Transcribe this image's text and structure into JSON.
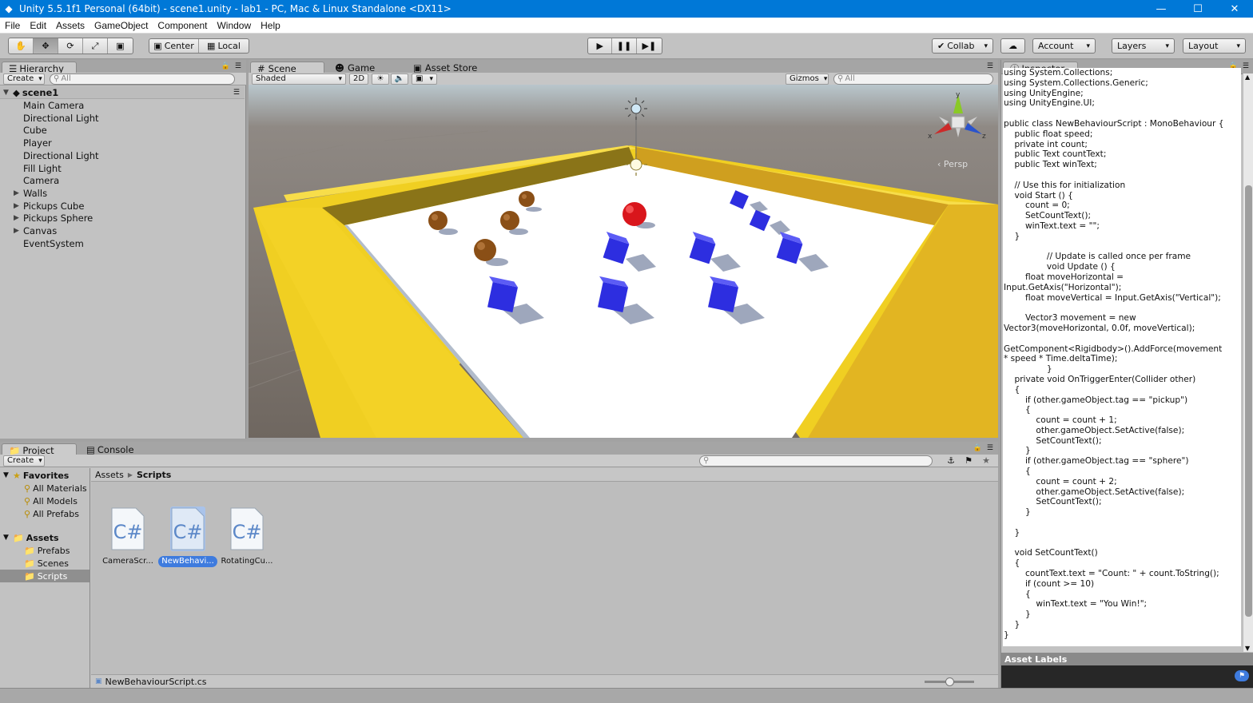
{
  "window": {
    "title": "Unity 5.5.1f1 Personal (64bit) - scene1.unity - lab1 - PC, Mac & Linux Standalone <DX11>",
    "minimize": "—",
    "maximize": "☐",
    "close": "✕"
  },
  "menu": [
    "File",
    "Edit",
    "Assets",
    "GameObject",
    "Component",
    "Window",
    "Help"
  ],
  "toolbar": {
    "pivot": "Center",
    "space": "Local",
    "collab": "Collab",
    "account": "Account",
    "layers": "Layers",
    "layout": "Layout"
  },
  "hierarchy": {
    "tab": "Hierarchy",
    "create": "Create",
    "search_placeholder": "All",
    "scene": "scene1",
    "items": [
      {
        "label": "Main Camera",
        "expandable": false
      },
      {
        "label": "Directional Light",
        "expandable": false
      },
      {
        "label": "Cube",
        "expandable": false
      },
      {
        "label": "Player",
        "expandable": false
      },
      {
        "label": "Directional Light",
        "expandable": false
      },
      {
        "label": "Fill Light",
        "expandable": false
      },
      {
        "label": "Camera",
        "expandable": false
      },
      {
        "label": "Walls",
        "expandable": true
      },
      {
        "label": "Pickups Cube",
        "expandable": true
      },
      {
        "label": "Pickups Sphere",
        "expandable": true
      },
      {
        "label": "Canvas",
        "expandable": true
      },
      {
        "label": "EventSystem",
        "expandable": false
      }
    ]
  },
  "scene": {
    "tabs": [
      "Scene",
      "Game",
      "Asset Store"
    ],
    "shading": "Shaded",
    "mode_2d": "2D",
    "gizmos": "Gizmos",
    "search_placeholder": "All",
    "persp_label": "Persp",
    "axis_x": "x",
    "axis_y": "y",
    "axis_z": "z"
  },
  "project": {
    "tabs": [
      "Project",
      "Console"
    ],
    "create": "Create",
    "favorites_label": "Favorites",
    "favorites": [
      "All Materials",
      "All Models",
      "All Prefabs"
    ],
    "assets_label": "Assets",
    "asset_folders": [
      "Prefabs",
      "Scenes",
      "Scripts"
    ],
    "breadcrumb": [
      "Assets",
      "Scripts"
    ],
    "files": [
      {
        "label": "CameraScr...",
        "selected": false
      },
      {
        "label": "NewBehavi...",
        "selected": true
      },
      {
        "label": "RotatingCu...",
        "selected": false
      }
    ],
    "status_file": "NewBehaviourScript.cs"
  },
  "inspector": {
    "tab": "Inspector",
    "code_lines": [
      "using System.Collections;",
      "using System.Collections.Generic;",
      "using UnityEngine;",
      "using UnityEngine.UI;",
      "",
      "public class NewBehaviourScript : MonoBehaviour {",
      "    public float speed;",
      "    private int count;",
      "    public Text countText;",
      "    public Text winText;",
      "",
      "    // Use this for initialization",
      "    void Start () {",
      "        count = 0;",
      "        SetCountText();",
      "        winText.text = \"\";",
      "    }",
      "",
      "                // Update is called once per frame",
      "                void Update () {",
      "        float moveHorizontal =",
      "Input.GetAxis(\"Horizontal\");",
      "        float moveVertical = Input.GetAxis(\"Vertical\");",
      "",
      "        Vector3 movement = new",
      "Vector3(moveHorizontal, 0.0f, moveVertical);",
      "",
      "GetComponent<Rigidbody>().AddForce(movement",
      "* speed * Time.deltaTime);",
      "                }",
      "    private void OnTriggerEnter(Collider other)",
      "    {",
      "        if (other.gameObject.tag == \"pickup\")",
      "        {",
      "            count = count + 1;",
      "            other.gameObject.SetActive(false);",
      "            SetCountText();",
      "        }",
      "        if (other.gameObject.tag == \"sphere\")",
      "        {",
      "            count = count + 2;",
      "            other.gameObject.SetActive(false);",
      "            SetCountText();",
      "        }",
      "",
      "    }",
      "",
      "    void SetCountText()",
      "    {",
      "        countText.text = \"Count: \" + count.ToString();",
      "        if (count >= 10)",
      "        {",
      "            winText.text = \"You Win!\";",
      "        }",
      "    }",
      "}"
    ],
    "asset_labels": "Asset Labels"
  },
  "colors": {
    "titlebar": "#0078d7",
    "panel": "#c2c2c2",
    "selection": "#3e7bde",
    "wall_yellow": "#f5d327",
    "pickup_cube": "#2d2ee0",
    "pickup_sphere": "#8a4f16",
    "player": "#d9161c"
  }
}
